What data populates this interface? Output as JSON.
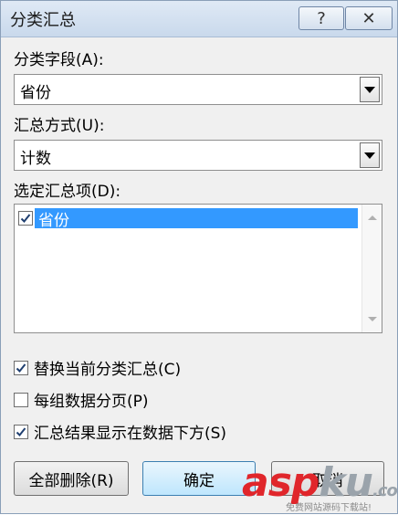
{
  "window": {
    "title": "分类汇总",
    "help_glyph": "?",
    "close_glyph": "✕"
  },
  "group_by": {
    "label": "分类字段(A):",
    "value": "省份"
  },
  "function": {
    "label": "汇总方式(U):",
    "value": "计数"
  },
  "subtotal_items": {
    "label": "选定汇总项(D):",
    "items": [
      {
        "label": "省份",
        "checked": true,
        "selected": true
      }
    ]
  },
  "options": [
    {
      "label": "替换当前分类汇总(C)",
      "checked": true
    },
    {
      "label": "每组数据分页(P)",
      "checked": false
    },
    {
      "label": "汇总结果显示在数据下方(S)",
      "checked": true
    }
  ],
  "buttons": {
    "remove_all": "全部删除(R)",
    "ok": "确定",
    "cancel": "取消"
  },
  "watermark": {
    "brand_red": "asp",
    "brand_gray": "ku",
    "brand_suffix": ".com",
    "tagline": "免费网站源码下载站!"
  },
  "colors": {
    "selection": "#3399ff",
    "title_bar": "#c9d9ec",
    "dialog_bg": "#f0f0f0"
  }
}
